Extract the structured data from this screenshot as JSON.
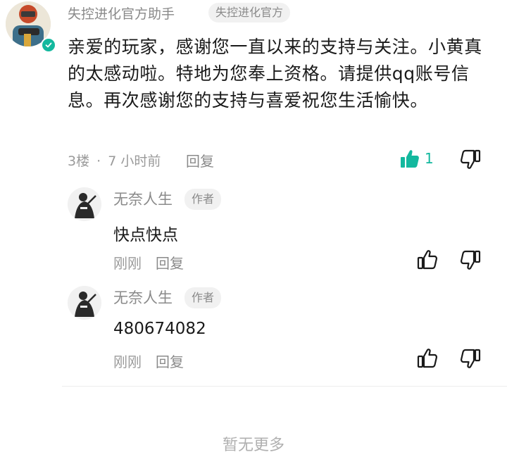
{
  "comment": {
    "author": "失控进化官方助手",
    "badge": "失控进化官方",
    "text": "亲爱的玩家，感谢您一直以来的支持与关注。小黄真的太感动啦。特地为您奉上资格。请提供qq账号信息。再次感谢您的支持与喜爱祝您生活愉快。",
    "floor": "3楼",
    "separator": "·",
    "time": "7 小时前",
    "reply_label": "回复",
    "like_count": "1",
    "liked": true,
    "accent_color": "#13b89e"
  },
  "replies": [
    {
      "author": "无奈人生",
      "badge": "作者",
      "text": "快点快点",
      "time": "刚刚",
      "reply_label": "回复"
    },
    {
      "author": "无奈人生",
      "badge": "作者",
      "text": "480674082",
      "time": "刚刚",
      "reply_label": "回复"
    }
  ],
  "footer": {
    "no_more": "暂无更多"
  }
}
